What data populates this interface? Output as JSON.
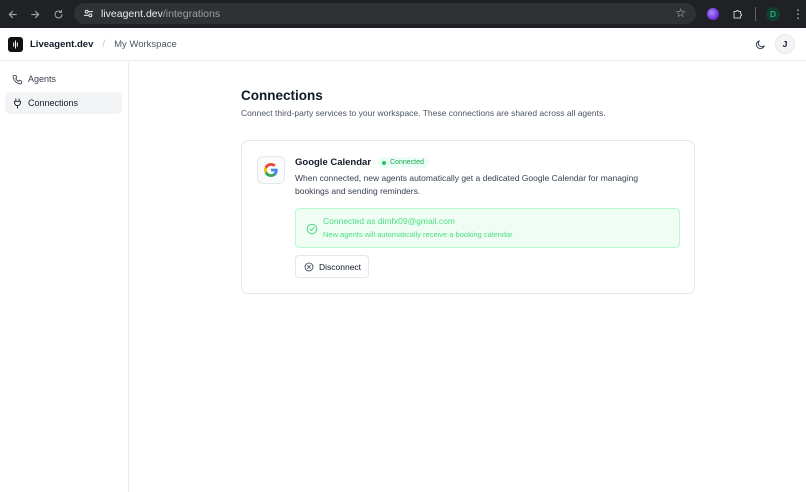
{
  "browser": {
    "url_host": "liveagent.dev",
    "url_path": "/integrations",
    "profile_initial": "D"
  },
  "header": {
    "brand": "Liveagent.dev",
    "separator": "/",
    "workspace": "My Workspace",
    "user_initial": "J"
  },
  "sidebar": {
    "items": [
      {
        "label": "Agents",
        "icon": "phone-icon",
        "active": false
      },
      {
        "label": "Connections",
        "icon": "plug-icon",
        "active": true
      }
    ]
  },
  "main": {
    "title": "Connections",
    "description": "Connect third-party services to your workspace. These connections are shared across all agents.",
    "connection": {
      "service_name": "Google Calendar",
      "status": "Connected",
      "description": "When connected, new agents automatically get a dedicated Google Calendar for managing bookings and sending reminders.",
      "alert_title": "Connected as dimfx09@gmail.com",
      "alert_subtitle": "New agents will automatically receive a booking calendar",
      "disconnect_label": "Disconnect"
    }
  },
  "colors": {
    "success_text": "#4ade80",
    "success_bg": "#f0fdf4",
    "success_border": "#bbf7d0",
    "browser_chrome": "#202124"
  }
}
